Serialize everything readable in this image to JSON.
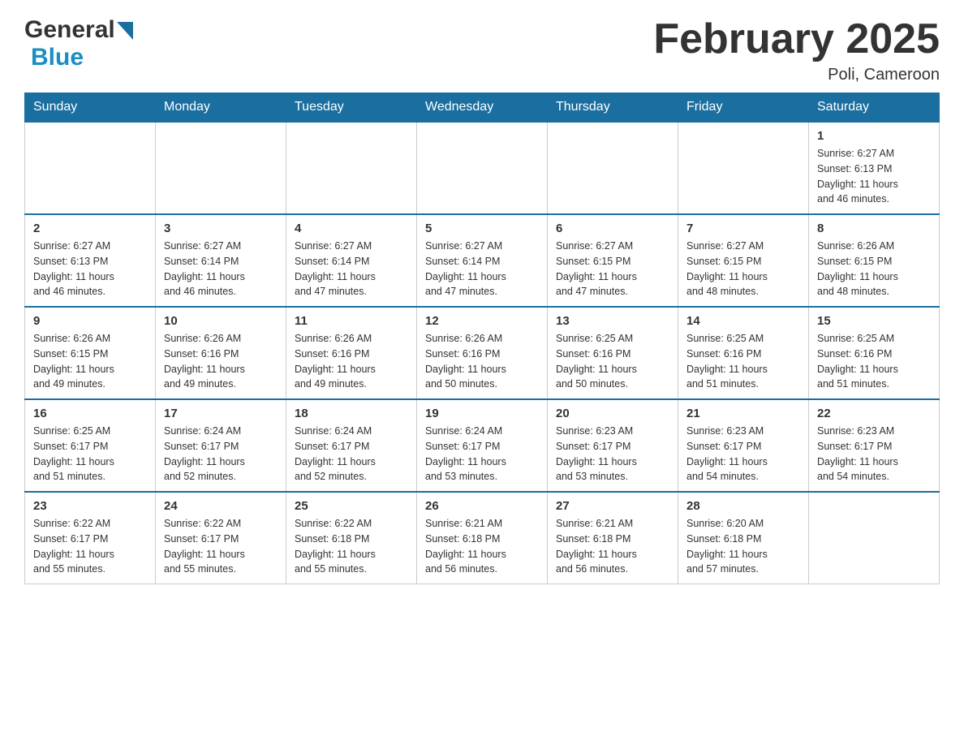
{
  "header": {
    "logo_general": "General",
    "logo_blue": "Blue",
    "month_title": "February 2025",
    "location": "Poli, Cameroon"
  },
  "days_of_week": [
    "Sunday",
    "Monday",
    "Tuesday",
    "Wednesday",
    "Thursday",
    "Friday",
    "Saturday"
  ],
  "weeks": [
    {
      "days": [
        {
          "number": "",
          "info": "",
          "empty": true
        },
        {
          "number": "",
          "info": "",
          "empty": true
        },
        {
          "number": "",
          "info": "",
          "empty": true
        },
        {
          "number": "",
          "info": "",
          "empty": true
        },
        {
          "number": "",
          "info": "",
          "empty": true
        },
        {
          "number": "",
          "info": "",
          "empty": true
        },
        {
          "number": "1",
          "info": "Sunrise: 6:27 AM\nSunset: 6:13 PM\nDaylight: 11 hours\nand 46 minutes."
        }
      ]
    },
    {
      "days": [
        {
          "number": "2",
          "info": "Sunrise: 6:27 AM\nSunset: 6:13 PM\nDaylight: 11 hours\nand 46 minutes."
        },
        {
          "number": "3",
          "info": "Sunrise: 6:27 AM\nSunset: 6:14 PM\nDaylight: 11 hours\nand 46 minutes."
        },
        {
          "number": "4",
          "info": "Sunrise: 6:27 AM\nSunset: 6:14 PM\nDaylight: 11 hours\nand 47 minutes."
        },
        {
          "number": "5",
          "info": "Sunrise: 6:27 AM\nSunset: 6:14 PM\nDaylight: 11 hours\nand 47 minutes."
        },
        {
          "number": "6",
          "info": "Sunrise: 6:27 AM\nSunset: 6:15 PM\nDaylight: 11 hours\nand 47 minutes."
        },
        {
          "number": "7",
          "info": "Sunrise: 6:27 AM\nSunset: 6:15 PM\nDaylight: 11 hours\nand 48 minutes."
        },
        {
          "number": "8",
          "info": "Sunrise: 6:26 AM\nSunset: 6:15 PM\nDaylight: 11 hours\nand 48 minutes."
        }
      ]
    },
    {
      "days": [
        {
          "number": "9",
          "info": "Sunrise: 6:26 AM\nSunset: 6:15 PM\nDaylight: 11 hours\nand 49 minutes."
        },
        {
          "number": "10",
          "info": "Sunrise: 6:26 AM\nSunset: 6:16 PM\nDaylight: 11 hours\nand 49 minutes."
        },
        {
          "number": "11",
          "info": "Sunrise: 6:26 AM\nSunset: 6:16 PM\nDaylight: 11 hours\nand 49 minutes."
        },
        {
          "number": "12",
          "info": "Sunrise: 6:26 AM\nSunset: 6:16 PM\nDaylight: 11 hours\nand 50 minutes."
        },
        {
          "number": "13",
          "info": "Sunrise: 6:25 AM\nSunset: 6:16 PM\nDaylight: 11 hours\nand 50 minutes."
        },
        {
          "number": "14",
          "info": "Sunrise: 6:25 AM\nSunset: 6:16 PM\nDaylight: 11 hours\nand 51 minutes."
        },
        {
          "number": "15",
          "info": "Sunrise: 6:25 AM\nSunset: 6:16 PM\nDaylight: 11 hours\nand 51 minutes."
        }
      ]
    },
    {
      "days": [
        {
          "number": "16",
          "info": "Sunrise: 6:25 AM\nSunset: 6:17 PM\nDaylight: 11 hours\nand 51 minutes."
        },
        {
          "number": "17",
          "info": "Sunrise: 6:24 AM\nSunset: 6:17 PM\nDaylight: 11 hours\nand 52 minutes."
        },
        {
          "number": "18",
          "info": "Sunrise: 6:24 AM\nSunset: 6:17 PM\nDaylight: 11 hours\nand 52 minutes."
        },
        {
          "number": "19",
          "info": "Sunrise: 6:24 AM\nSunset: 6:17 PM\nDaylight: 11 hours\nand 53 minutes."
        },
        {
          "number": "20",
          "info": "Sunrise: 6:23 AM\nSunset: 6:17 PM\nDaylight: 11 hours\nand 53 minutes."
        },
        {
          "number": "21",
          "info": "Sunrise: 6:23 AM\nSunset: 6:17 PM\nDaylight: 11 hours\nand 54 minutes."
        },
        {
          "number": "22",
          "info": "Sunrise: 6:23 AM\nSunset: 6:17 PM\nDaylight: 11 hours\nand 54 minutes."
        }
      ]
    },
    {
      "days": [
        {
          "number": "23",
          "info": "Sunrise: 6:22 AM\nSunset: 6:17 PM\nDaylight: 11 hours\nand 55 minutes."
        },
        {
          "number": "24",
          "info": "Sunrise: 6:22 AM\nSunset: 6:17 PM\nDaylight: 11 hours\nand 55 minutes."
        },
        {
          "number": "25",
          "info": "Sunrise: 6:22 AM\nSunset: 6:18 PM\nDaylight: 11 hours\nand 55 minutes."
        },
        {
          "number": "26",
          "info": "Sunrise: 6:21 AM\nSunset: 6:18 PM\nDaylight: 11 hours\nand 56 minutes."
        },
        {
          "number": "27",
          "info": "Sunrise: 6:21 AM\nSunset: 6:18 PM\nDaylight: 11 hours\nand 56 minutes."
        },
        {
          "number": "28",
          "info": "Sunrise: 6:20 AM\nSunset: 6:18 PM\nDaylight: 11 hours\nand 57 minutes."
        },
        {
          "number": "",
          "info": "",
          "empty": true
        }
      ]
    }
  ]
}
